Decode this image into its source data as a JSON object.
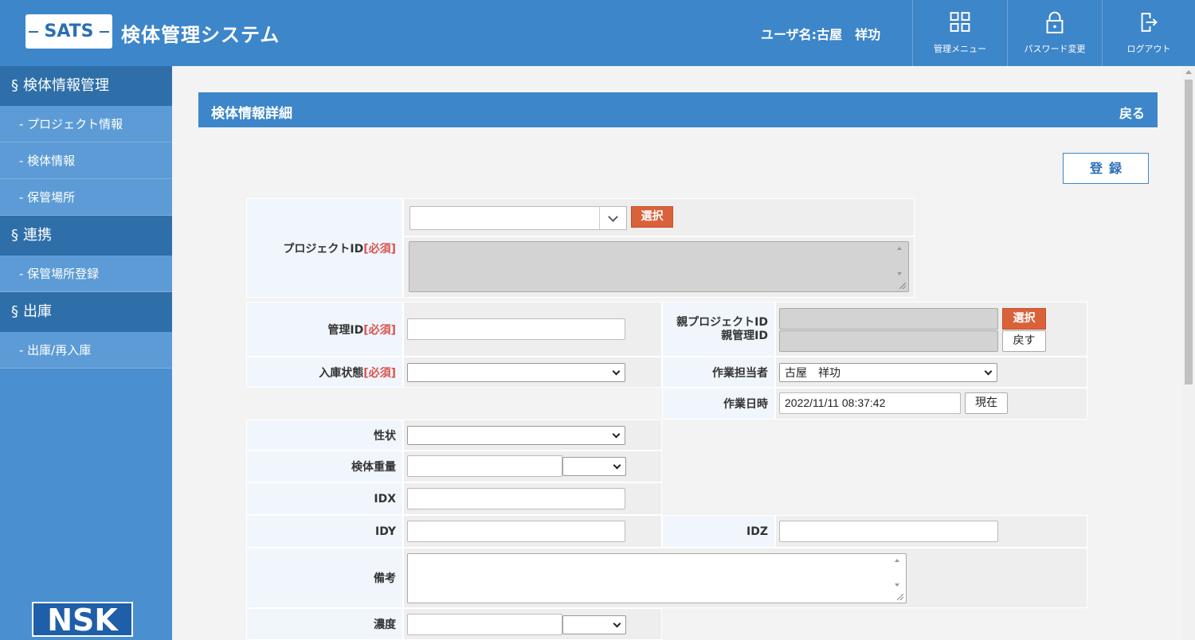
{
  "header": {
    "logo": "SATS",
    "app_title": "検体管理システム",
    "user": "ユーザ名:古屋　祥功",
    "buttons": {
      "admin_menu": "管理メニュー",
      "password": "パスワード変更",
      "logout": "ログアウト"
    }
  },
  "sidebar": {
    "sections": [
      {
        "label": "検体情報管理",
        "items": [
          "- プロジェクト情報",
          "- 検体情報",
          "- 保管場所"
        ]
      },
      {
        "label": "連携",
        "items": [
          "- 保管場所登録"
        ]
      },
      {
        "label": "出庫",
        "items": [
          "- 出庫/再入庫"
        ]
      }
    ],
    "section_mark": "§",
    "brand": "NSK"
  },
  "panel": {
    "title": "検体情報詳細",
    "back": "戻る",
    "register": "登録"
  },
  "form": {
    "required_tag": "[必須]",
    "project_id_label": "プロジェクトID",
    "select_label": "選択",
    "kanri_id_label": "管理ID",
    "parent_project_label": "親プロジェクトID",
    "parent_kanri_label": "親管理ID",
    "reset_label": "戻す",
    "nyuko_label": "入庫状態",
    "worker_label": "作業担当者",
    "worker_value": "古屋　祥功",
    "work_date_label": "作業日時",
    "work_date_value": "2022/11/11 08:37:42",
    "now_label": "現在",
    "seijo_label": "性状",
    "weight_label": "検体重量",
    "idx_label": "IDX",
    "idy_label": "IDY",
    "idz_label": "IDZ",
    "note_label": "備考",
    "conc_label": "濃度"
  }
}
